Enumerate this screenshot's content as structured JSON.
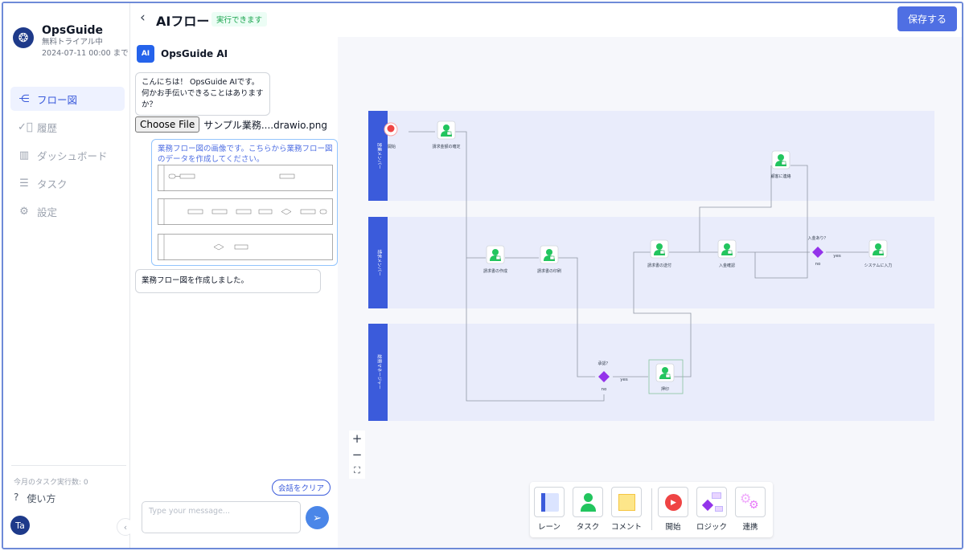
{
  "brand": {
    "name": "OpsGuide",
    "plan": "無料トライアル中",
    "trial_until": "2024-07-11 00:00 まで"
  },
  "nav": [
    {
      "label": "フロー図",
      "icon": "flow-icon",
      "active": true
    },
    {
      "label": "履歴",
      "icon": "check-circle-icon",
      "active": false
    },
    {
      "label": "ダッシュボード",
      "icon": "chart-icon",
      "active": false
    },
    {
      "label": "タスク",
      "icon": "list-icon",
      "active": false
    },
    {
      "label": "設定",
      "icon": "gear-icon",
      "active": false
    }
  ],
  "sidebar_footer": {
    "quota_label": "今月のタスク実行数: 0",
    "help_label": "使い方",
    "avatar_initials": "Ta"
  },
  "header": {
    "title": "AIフロー",
    "status": "実行できます",
    "save_label": "保存する"
  },
  "chat": {
    "ai_name": "OpsGuide AI",
    "ai_icon_label": "AI",
    "greeting": "こんにちは！ OpsGuide AIです。何かお手伝いできることはありますか？",
    "file_button": "Choose File",
    "file_name": "サンプル業務....drawio.png",
    "user_message": "業務フロー図の画像です。こちらから業務フロー図のデータを作成してください。",
    "ai_reply": "業務フロー図を作成しました。",
    "clear_label": "会話をクリア",
    "input_placeholder": "Type your message..."
  },
  "flow": {
    "lanes": [
      "営業メンバー",
      "請求メンバー",
      "総務マネージャー"
    ],
    "nodes": {
      "start": "開始",
      "confirm_amount": "請求金額の確定",
      "notify_customer": "顧客に連絡",
      "create_invoice": "請求書の作成",
      "print_invoice": "請求書の印刷",
      "send_invoice": "請求書の送付",
      "confirm_payment": "入金確認",
      "payment_question": "入金あり？",
      "enter_system": "システムに入力",
      "approval_question": "承認？",
      "stamp": "押印"
    },
    "edge_labels": {
      "yes": "yes",
      "no": "no"
    }
  },
  "zoom": {
    "in": "+",
    "out": "−",
    "fit": "⛶"
  },
  "palette": [
    {
      "label": "レーン",
      "icon": "lane-icon"
    },
    {
      "label": "タスク",
      "icon": "task-person-icon"
    },
    {
      "label": "コメント",
      "icon": "comment-note-icon"
    },
    {
      "label": "開始",
      "icon": "start-play-icon"
    },
    {
      "label": "ロジック",
      "icon": "logic-diamond-icon"
    },
    {
      "label": "連携",
      "icon": "integration-gear-icon"
    }
  ],
  "colors": {
    "accent": "#4f6fe3",
    "lane_band": "#3b5bdb",
    "task_green": "#22c55e",
    "logic_purple": "#9333ea",
    "start_red": "#ef4444"
  }
}
